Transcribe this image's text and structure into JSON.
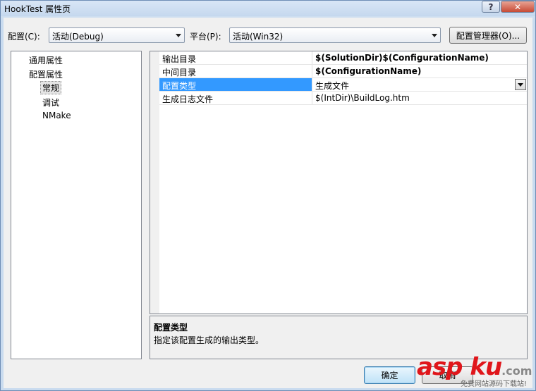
{
  "window": {
    "title": "HookTest 属性页",
    "help_label": "?",
    "close_label": "✕"
  },
  "toolbar": {
    "config_label": "配置(C):",
    "config_value": "活动(Debug)",
    "platform_label": "平台(P):",
    "platform_value": "活动(Win32)",
    "config_manager_label": "配置管理器(O)..."
  },
  "tree": {
    "items": [
      {
        "label": "通用属性"
      },
      {
        "label": "配置属性"
      },
      {
        "label": "常规"
      },
      {
        "label": "调试"
      },
      {
        "label": "NMake"
      }
    ]
  },
  "grid": {
    "rows": [
      {
        "name": "输出目录",
        "value": "$(SolutionDir)$(ConfigurationName)"
      },
      {
        "name": "中间目录",
        "value": "$(ConfigurationName)"
      },
      {
        "name": "配置类型",
        "value": "生成文件"
      },
      {
        "name": "生成日志文件",
        "value": "$(IntDir)\\BuildLog.htm"
      }
    ]
  },
  "description": {
    "title": "配置类型",
    "text": "指定该配置生成的输出类型。"
  },
  "buttons": {
    "ok_label": "确定",
    "cancel_label": "取消"
  },
  "watermark": {
    "brand": "asp ku",
    "suffix": ".com",
    "tagline": "免费网站源码下载站!"
  }
}
